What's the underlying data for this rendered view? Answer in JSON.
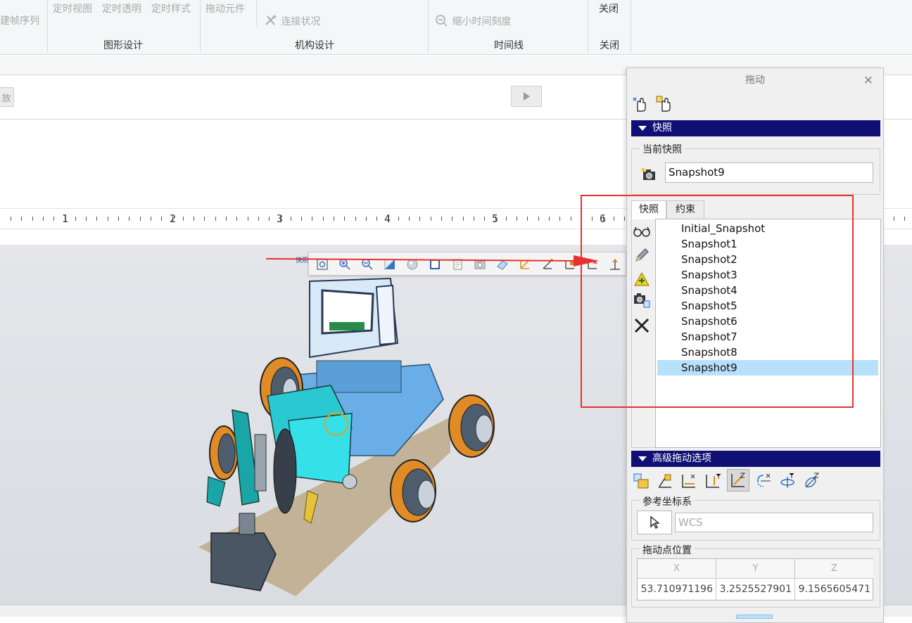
{
  "ribbon": {
    "left_cut_label": "建帧序列",
    "graphics_items": [
      "定时视图",
      "定时透明",
      "定时样式"
    ],
    "graphics_group": "图形设计",
    "drag_component": "拖动元件",
    "connect_status": "连接状况",
    "mechanism_group": "机构设计",
    "shrink_time_scale": "缩小时间刻度",
    "timeline_group": "时间线",
    "close_label": "关闭",
    "close_group": "关闭"
  },
  "strip": {
    "left_button_label": "放"
  },
  "ruler": {
    "labels": [
      "1",
      "2",
      "3",
      "4",
      "5",
      "6"
    ]
  },
  "minitoolbar": {
    "label": "快照"
  },
  "dialog": {
    "title": "拖动",
    "close_glyph": "×",
    "snapshot_section": "快照",
    "current_snapshot_legend": "当前快照",
    "current_snapshot_value": "Snapshot9",
    "tabs": [
      "快照",
      "约束"
    ],
    "snapshots": [
      "Initial_Snapshot",
      "Snapshot1",
      "Snapshot2",
      "Snapshot3",
      "Snapshot4",
      "Snapshot5",
      "Snapshot6",
      "Snapshot7",
      "Snapshot8",
      "Snapshot9"
    ],
    "selected_snapshot": "Snapshot9",
    "advanced_section": "高级拖动选项",
    "ref_coord_legend": "参考坐标系",
    "ref_coord_value": "WCS",
    "drag_point_legend": "拖动点位置",
    "columns": [
      "X",
      "Y",
      "Z"
    ],
    "values": [
      "53.710971196",
      "3.2525527901",
      "9.1565605471"
    ]
  },
  "colors": {
    "section_header": "#0f0f75",
    "selected_row": "#b7e0fb",
    "highlight_box": "#e8322f",
    "annotation_arrow": "#e8322f"
  }
}
